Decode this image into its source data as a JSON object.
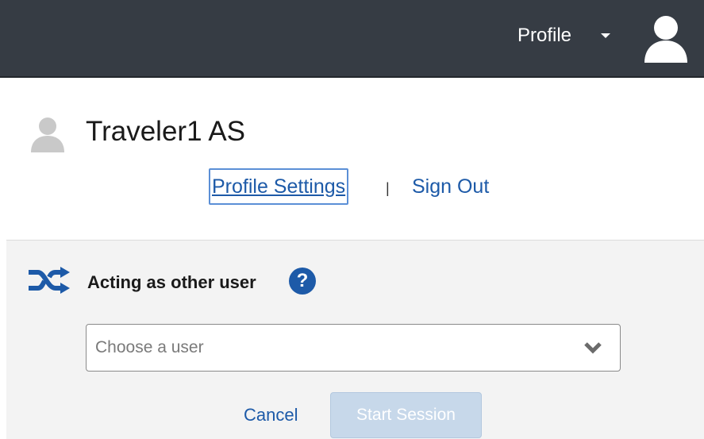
{
  "topbar": {
    "profile_label": "Profile",
    "caret_icon": "caret-down-icon",
    "avatar_icon": "user-avatar-icon",
    "background": "#363c44"
  },
  "user": {
    "name": "Traveler1 AS",
    "avatar_icon": "user-avatar-icon"
  },
  "links": {
    "profile_settings": "Profile Settings",
    "separator": "|",
    "sign_out": "Sign Out"
  },
  "acting": {
    "icon": "shuffle-icon",
    "title": "Acting as other user",
    "help_icon": "question-circle-icon",
    "help_glyph": "?",
    "select_placeholder": "Choose a user",
    "select_icon": "chevron-down-icon",
    "cancel_label": "Cancel",
    "start_label": "Start Session"
  },
  "colors": {
    "link": "#1d5aa8",
    "accent": "#1d5aa8",
    "disabled_button": "#c7d8ea"
  }
}
